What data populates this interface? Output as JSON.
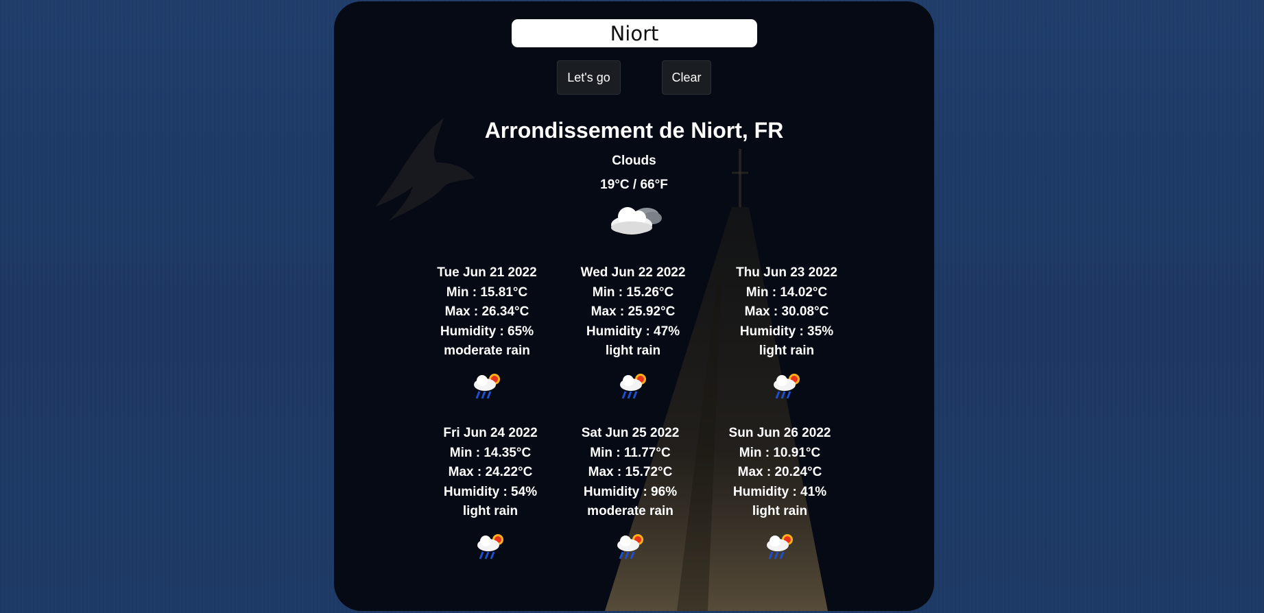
{
  "search": {
    "value": "Niort"
  },
  "buttons": {
    "go_label": "Let's go",
    "clear_label": "Clear"
  },
  "current": {
    "city": "Arrondissement de Niort, FR",
    "description": "Clouds",
    "temperature": "19°C / 66°F",
    "icon": "partly-cloudy-icon"
  },
  "forecast": [
    {
      "date": "Tue Jun 21 2022",
      "min": "Min : 15.81°C",
      "max": "Max : 26.34°C",
      "humidity": "Humidity : 65%",
      "desc": "moderate rain",
      "icon": "rain-sun-icon"
    },
    {
      "date": "Wed Jun 22 2022",
      "min": "Min : 15.26°C",
      "max": "Max : 25.92°C",
      "humidity": "Humidity : 47%",
      "desc": "light rain",
      "icon": "rain-sun-icon"
    },
    {
      "date": "Thu Jun 23 2022",
      "min": "Min : 14.02°C",
      "max": "Max : 30.08°C",
      "humidity": "Humidity : 35%",
      "desc": "light rain",
      "icon": "rain-sun-icon"
    },
    {
      "date": "Fri Jun 24 2022",
      "min": "Min : 14.35°C",
      "max": "Max : 24.22°C",
      "humidity": "Humidity : 54%",
      "desc": "light rain",
      "icon": "rain-sun-icon"
    },
    {
      "date": "Sat Jun 25 2022",
      "min": "Min : 11.77°C",
      "max": "Max : 15.72°C",
      "humidity": "Humidity : 96%",
      "desc": "moderate rain",
      "icon": "rain-sun-icon"
    },
    {
      "date": "Sun Jun 26 2022",
      "min": "Min : 10.91°C",
      "max": "Max : 20.24°C",
      "humidity": "Humidity : 41%",
      "desc": "light rain",
      "icon": "rain-sun-icon"
    }
  ],
  "colors": {
    "page_bg": "#1f3a66",
    "panel_bg": "#050a14",
    "button_bg": "#1a1d22",
    "text": "#ffffff"
  }
}
